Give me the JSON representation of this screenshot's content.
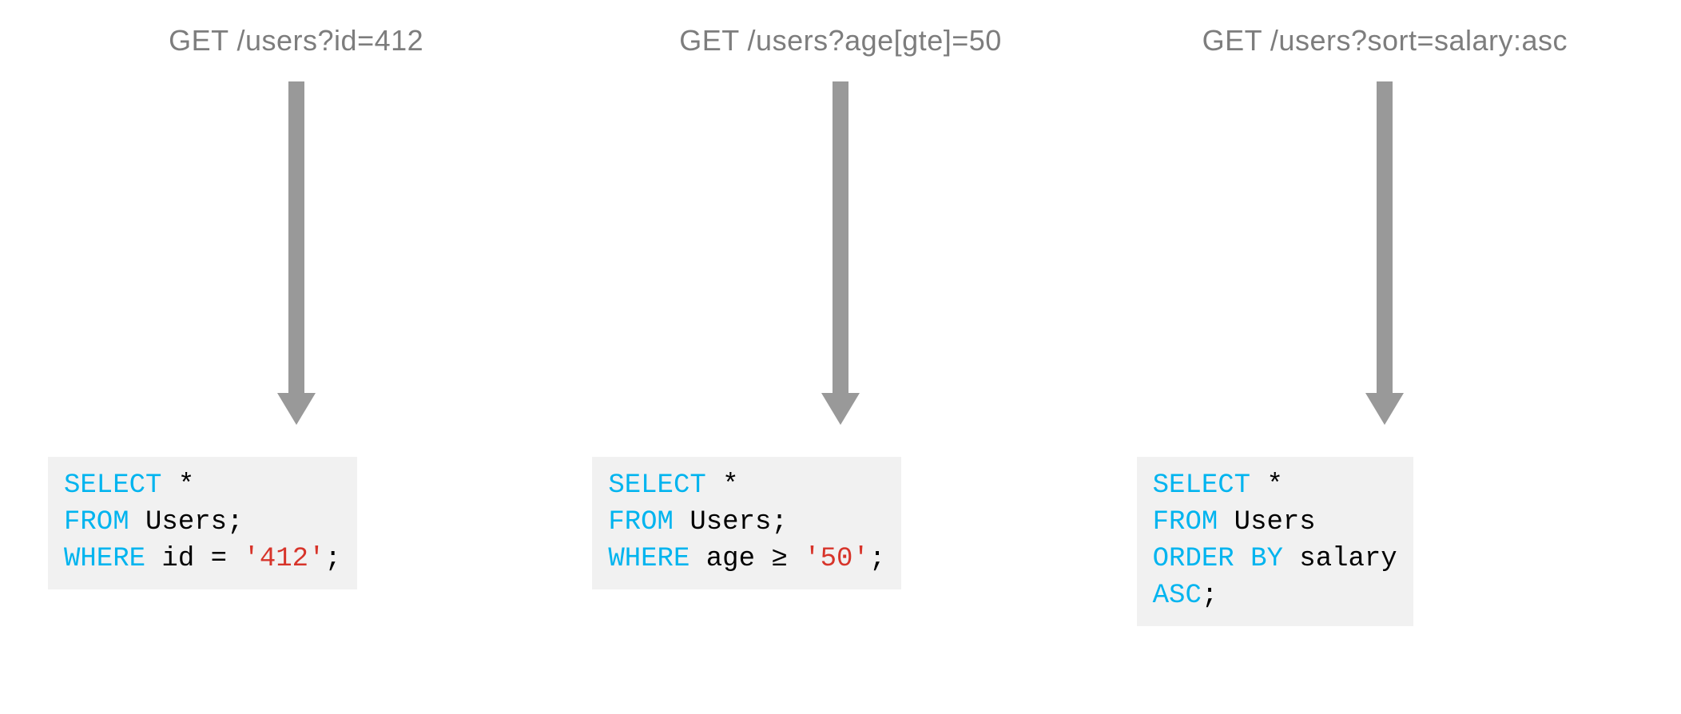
{
  "columns": [
    {
      "request": "GET /users?id=412",
      "sql": {
        "tokens": [
          {
            "t": "kw",
            "v": "SELECT"
          },
          {
            "t": "tx",
            "v": " *\n"
          },
          {
            "t": "kw",
            "v": "FROM"
          },
          {
            "t": "tx",
            "v": " Users;\n"
          },
          {
            "t": "kw",
            "v": "WHERE"
          },
          {
            "t": "tx",
            "v": " id = "
          },
          {
            "t": "lit",
            "v": "'412'"
          },
          {
            "t": "tx",
            "v": ";"
          }
        ]
      }
    },
    {
      "request": "GET /users?age[gte]=50",
      "sql": {
        "tokens": [
          {
            "t": "kw",
            "v": "SELECT"
          },
          {
            "t": "tx",
            "v": " *\n"
          },
          {
            "t": "kw",
            "v": "FROM"
          },
          {
            "t": "tx",
            "v": " Users;\n"
          },
          {
            "t": "kw",
            "v": "WHERE"
          },
          {
            "t": "tx",
            "v": " age ≥ "
          },
          {
            "t": "lit",
            "v": "'50'"
          },
          {
            "t": "tx",
            "v": ";"
          }
        ]
      }
    },
    {
      "request": "GET /users?sort=salary:asc",
      "sql": {
        "tokens": [
          {
            "t": "kw",
            "v": "SELECT"
          },
          {
            "t": "tx",
            "v": " *\n"
          },
          {
            "t": "kw",
            "v": "FROM"
          },
          {
            "t": "tx",
            "v": " Users\n"
          },
          {
            "t": "kw",
            "v": "ORDER BY"
          },
          {
            "t": "tx",
            "v": " salary\n"
          },
          {
            "t": "kw",
            "v": "ASC"
          },
          {
            "t": "tx",
            "v": ";"
          }
        ]
      }
    }
  ],
  "colors": {
    "text_gray": "#7d7d7d",
    "sql_bg": "#f1f1f1",
    "keyword": "#00b4ef",
    "literal": "#d7342a",
    "arrow": "#999999"
  }
}
